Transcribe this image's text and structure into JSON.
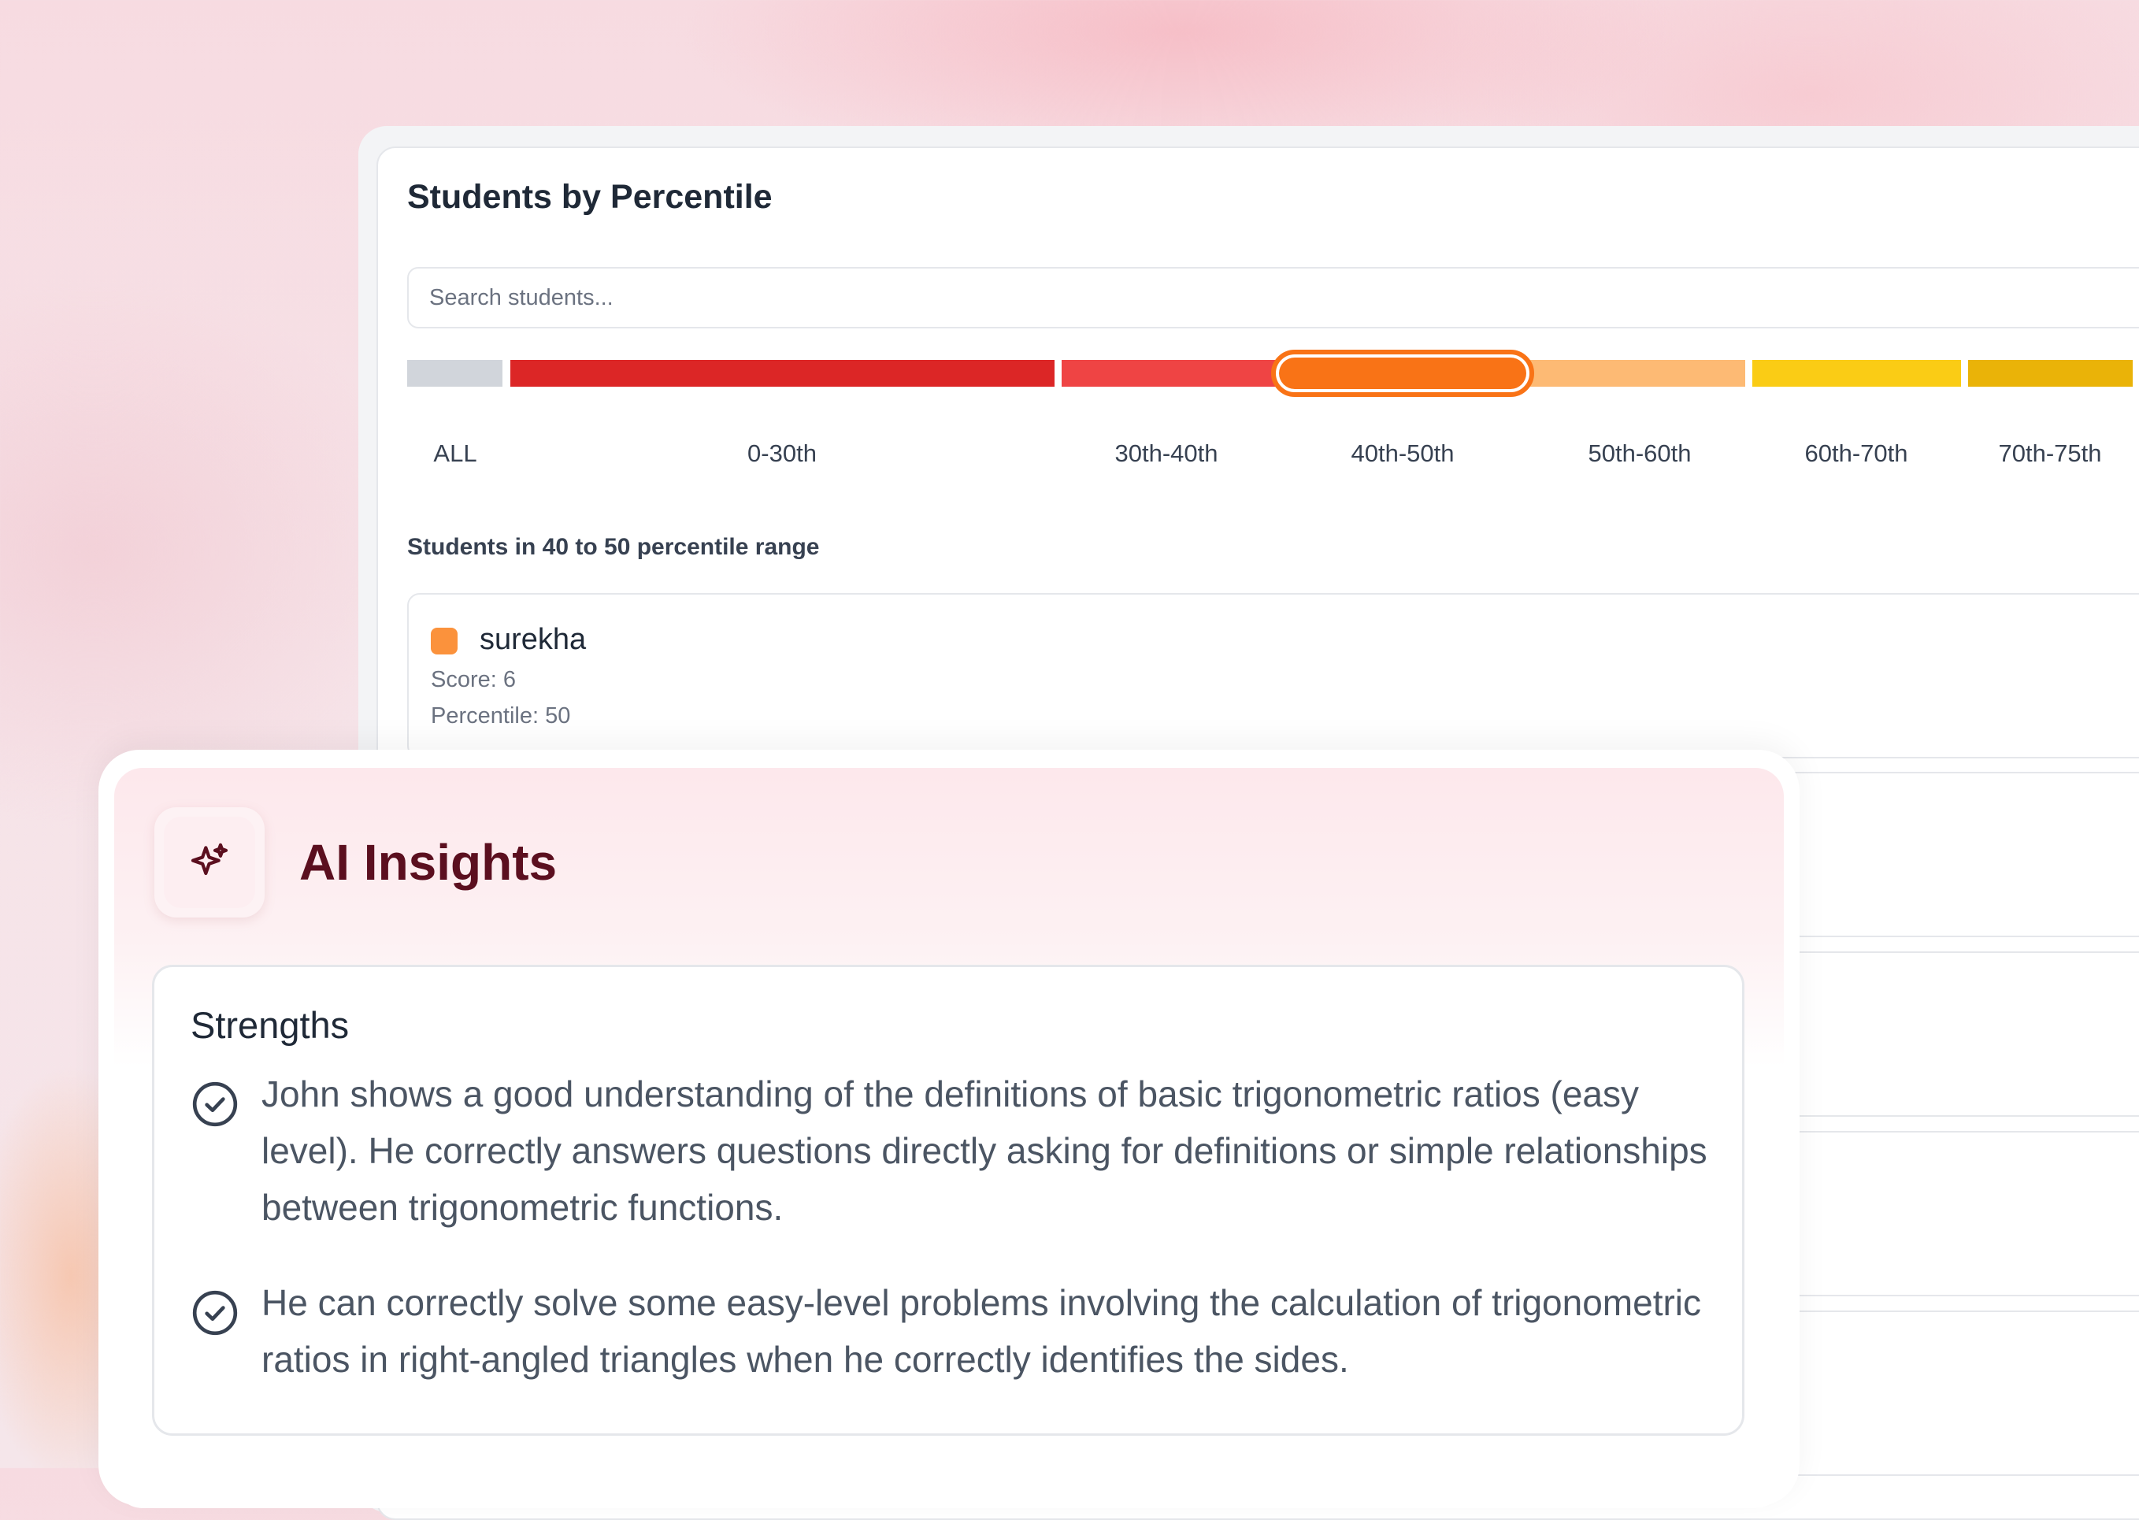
{
  "percentile_panel": {
    "title": "Students by Percentile",
    "search": {
      "placeholder": "Search students...",
      "value": ""
    },
    "segments": [
      {
        "label": "ALL",
        "color": "#d1d5db",
        "selected": false
      },
      {
        "label": "0-30th",
        "color": "#dc2626",
        "selected": false
      },
      {
        "label": "30th-40th",
        "color": "#ef4444",
        "selected": false
      },
      {
        "label": "40th-50th",
        "color": "#f97316",
        "selected": true
      },
      {
        "label": "50th-60th",
        "color": "#fdba74",
        "selected": false
      },
      {
        "label": "60th-70th",
        "color": "#facc15",
        "selected": false
      },
      {
        "label": "70th-75th",
        "color": "#eab308",
        "selected": false
      }
    ],
    "range_heading": "Students in 40 to 50 percentile range",
    "students": [
      {
        "name": "surekha",
        "score_text": "Score: 6",
        "percentile_text": "Percentile: 50",
        "color": "#fb923c"
      }
    ]
  },
  "ai_insights": {
    "title": "AI Insights",
    "icon": "sparkles-icon",
    "strengths": {
      "heading": "Strengths",
      "items": [
        "John shows a good understanding of the definitions of basic trigonometric ratios (easy level). He correctly answers questions directly asking for definitions or simple relationships between trigonometric functions.",
        "He can correctly solve some easy-level problems involving the calculation of trigonometric ratios in right-angled triangles when he correctly identifies the sides."
      ]
    }
  }
}
